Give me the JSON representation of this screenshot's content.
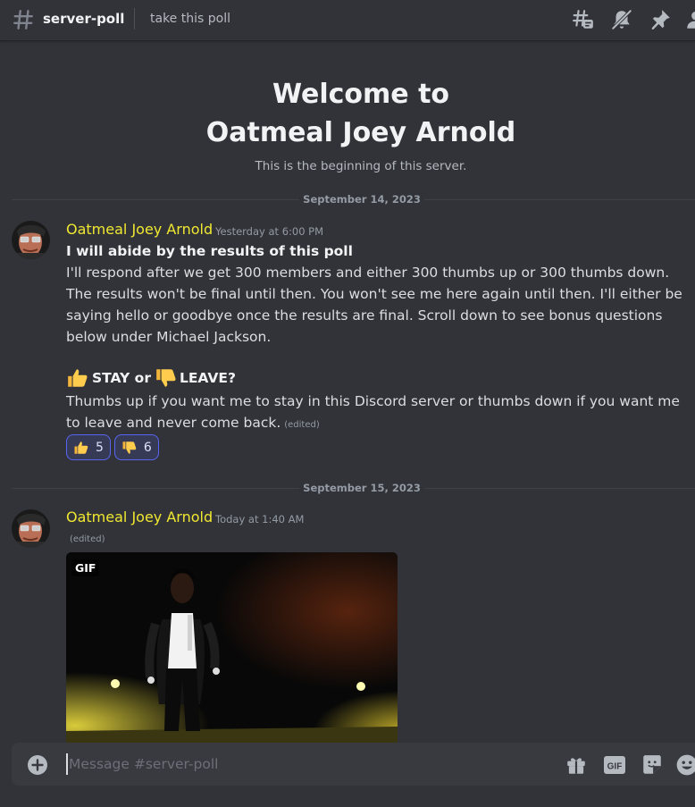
{
  "header": {
    "channel_name": "server-poll",
    "topic": "take this poll"
  },
  "welcome": {
    "line1": "Welcome to",
    "line2": "Oatmeal Joey Arnold",
    "subtitle": "This is the beginning of this server."
  },
  "dividers": [
    "September 14, 2023",
    "September 15, 2023"
  ],
  "messages": [
    {
      "author": "Oatmeal Joey Arnold",
      "timestamp": "Yesterday at 6:00 PM",
      "headline": "I will abide by the results of this poll",
      "body": "I'll respond after we get 300 members and either 300 thumbs up or 300 thumbs down. The results won't be final until then. You won't see me here again until then. I'll either be saying hello or goodbye once the results are final. Scroll down to see bonus questions below under Michael Jackson.",
      "stay_text": "STAY or",
      "leave_text": "LEAVE?",
      "footer": "Thumbs up if you want me to stay in this Discord server or thumbs down if you want me to leave and never come back.",
      "edited": "(edited)",
      "reactions": [
        {
          "emoji": "thumbs-up",
          "count": "5"
        },
        {
          "emoji": "thumbs-down",
          "count": "6"
        }
      ]
    },
    {
      "author": "Oatmeal Joey Arnold",
      "timestamp": "Today at 1:40 AM",
      "edited": "(edited)",
      "gif_badge": "GIF"
    }
  ],
  "composer": {
    "placeholder": "Message #server-poll",
    "gif_label": "GIF"
  },
  "colors": {
    "background": "#313338",
    "author": "#f0e830",
    "reaction_border": "#5865f2",
    "composer": "#383a40"
  }
}
